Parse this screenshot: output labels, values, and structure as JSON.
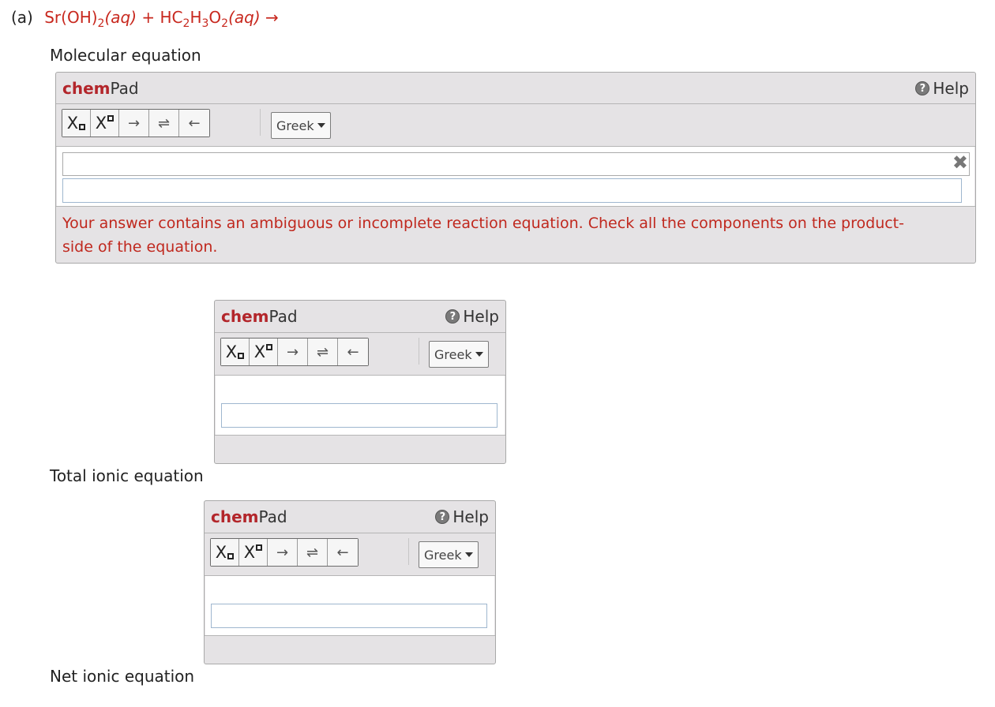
{
  "problem": {
    "label": "(a)",
    "reactant1": "Sr(OH)",
    "reactant1_sub": "2",
    "aq1": "(aq)",
    "plus": "+",
    "reactant2_a": "HC",
    "sub_a": "2",
    "reactant2_b": "H",
    "sub_b": "3",
    "reactant2_c": "O",
    "sub_c": "2",
    "aq2": "(aq)",
    "arrow": "→"
  },
  "labels": {
    "molecular": "Molecular equation",
    "total": "Total ionic equation",
    "net": "Net ionic equation"
  },
  "chempad": {
    "title_bold": "chem",
    "title_rest": "Pad",
    "help": "Help",
    "help_icon": "?",
    "greek": "Greek",
    "subscript_x": "X",
    "superscript_x": "X",
    "arrow_right": "→",
    "arrow_equilibrium": "⇌",
    "arrow_left": "←",
    "clear": "✖"
  },
  "pad1": {
    "error_line1": "Your answer contains an ambiguous or incomplete reaction equation. Check all the components on the product-",
    "error_line2": "side of the equation."
  },
  "colors": {
    "accent_red": "#c8281e",
    "brand_red": "#b3262b",
    "pad_bg": "#e5e3e5"
  }
}
